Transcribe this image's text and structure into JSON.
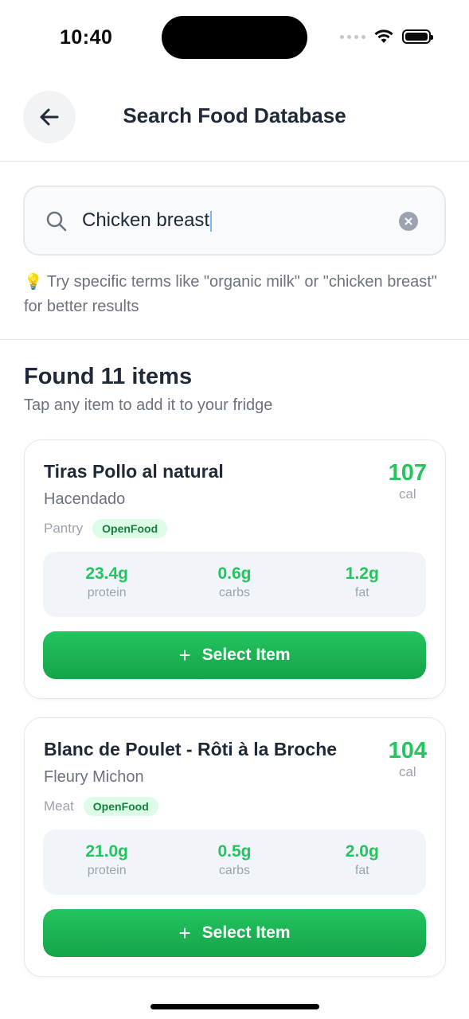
{
  "status_bar": {
    "time": "10:40"
  },
  "header": {
    "title": "Search Food Database"
  },
  "search": {
    "value": "Chicken breast",
    "tip": "Try specific terms like \"organic milk\" or \"chicken breast\" for better results"
  },
  "results": {
    "title": "Found 11 items",
    "subtitle": "Tap any item to add it to your fridge",
    "items": [
      {
        "name": "Tiras Pollo al natural",
        "brand": "Hacendado",
        "calories": "107",
        "cal_unit": "cal",
        "category": "Pantry",
        "source": "OpenFood",
        "protein": "23.4g",
        "carbs": "0.6g",
        "fat": "1.2g",
        "protein_label": "protein",
        "carbs_label": "carbs",
        "fat_label": "fat",
        "button": "Select Item"
      },
      {
        "name": "Blanc de Poulet - Rôti à la Broche",
        "brand": "Fleury Michon",
        "calories": "104",
        "cal_unit": "cal",
        "category": "Meat",
        "source": "OpenFood",
        "protein": "21.0g",
        "carbs": "0.5g",
        "fat": "2.0g",
        "protein_label": "protein",
        "carbs_label": "carbs",
        "fat_label": "fat",
        "button": "Select Item"
      }
    ]
  },
  "colors": {
    "accent": "#22c55e",
    "badge_bg": "#dcfce7",
    "badge_text": "#15803d"
  }
}
